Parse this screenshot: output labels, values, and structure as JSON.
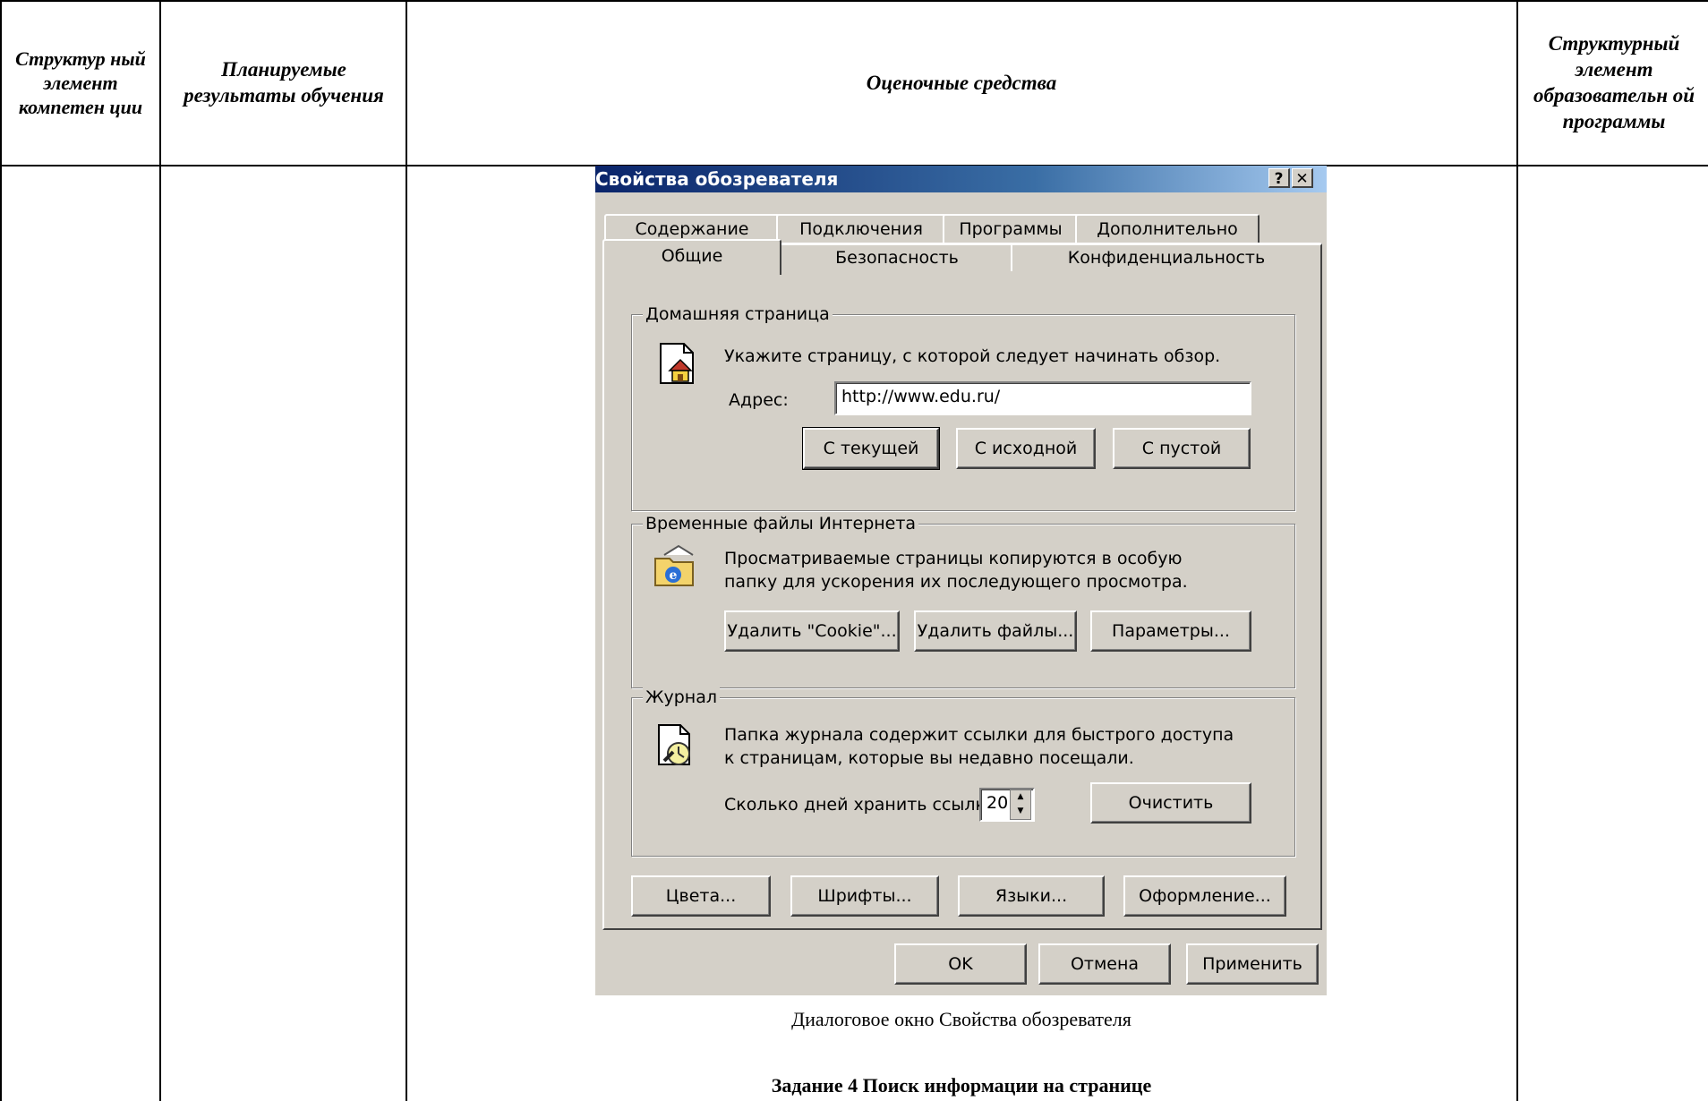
{
  "table": {
    "headers": [
      "Структур ный элемент компетен ции",
      "Планируемые результаты обучения",
      "Оценочные средства",
      "Структурный элемент образовательн ой программы"
    ]
  },
  "dialog": {
    "title": "Свойства обозревателя",
    "help_btn": "?",
    "close_btn": "✕",
    "tabs_back": [
      "Содержание",
      "Подключения",
      "Программы",
      "Дополнительно"
    ],
    "tabs_front": [
      "Общие",
      "Безопасность",
      "Конфиденциальность"
    ],
    "home": {
      "group_title": "Домашняя страница",
      "desc": "Укажите страницу, с которой следует начинать обзор.",
      "address_label": "Адрес:",
      "address_value": "http://www.edu.ru/",
      "btn_current": "С текущей",
      "btn_default": "С исходной",
      "btn_blank": "С пустой"
    },
    "temp": {
      "group_title": "Временные файлы Интернета",
      "desc_line1": "Просматриваемые страницы копируются в особую",
      "desc_line2": "папку для ускорения их последующего просмотра.",
      "btn_cookies": "Удалить \"Cookie\"...",
      "btn_files": "Удалить файлы...",
      "btn_settings": "Параметры..."
    },
    "history": {
      "group_title": "Журнал",
      "desc_line1": "Папка журнала содержит ссылки для быстрого доступа",
      "desc_line2": "к страницам, которые вы недавно посещали.",
      "days_label": "Сколько дней хранить ссылки:",
      "days_value": "20",
      "btn_clear": "Очистить"
    },
    "bottom_buttons": [
      "Цвета...",
      "Шрифты...",
      "Языки...",
      "Оформление..."
    ],
    "footer_buttons": [
      "OK",
      "Отмена",
      "Применить"
    ]
  },
  "caption": "Диалоговое окно Свойства обозревателя",
  "task_title": "Задание 4 Поиск информации на странице"
}
